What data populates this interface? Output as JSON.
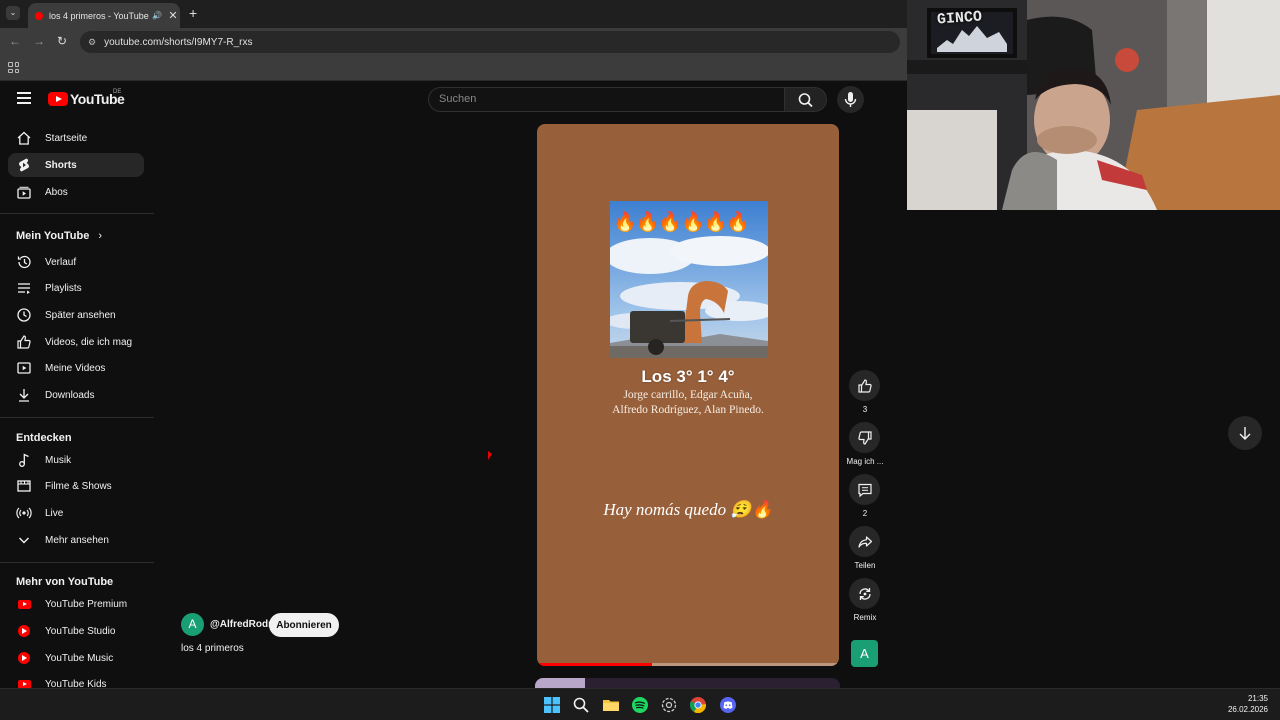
{
  "browser": {
    "tab_title": "los 4 primeros - YouTube",
    "tab_close": "✕",
    "new_tab": "+",
    "url": "youtube.com/shorts/I9MY7-R_rxs"
  },
  "header": {
    "logo_text": "YouTube",
    "country_code": "DE",
    "search_placeholder": "Suchen"
  },
  "sidebar": {
    "main_items": [
      {
        "label": "Startseite",
        "icon": "home-icon"
      },
      {
        "label": "Shorts",
        "icon": "shorts-icon",
        "active": true
      },
      {
        "label": "Abos",
        "icon": "subscriptions-icon"
      }
    ],
    "you_heading": "Mein YouTube",
    "you_items": [
      {
        "label": "Verlauf",
        "icon": "history-icon"
      },
      {
        "label": "Playlists",
        "icon": "playlists-icon"
      },
      {
        "label": "Später ansehen",
        "icon": "watch-later-icon"
      },
      {
        "label": "Videos, die ich mag",
        "icon": "liked-videos-icon"
      },
      {
        "label": "Meine Videos",
        "icon": "my-videos-icon"
      },
      {
        "label": "Downloads",
        "icon": "downloads-icon"
      }
    ],
    "explore_heading": "Entdecken",
    "explore_items": [
      {
        "label": "Musik",
        "icon": "music-icon"
      },
      {
        "label": "Filme & Shows",
        "icon": "movies-icon"
      },
      {
        "label": "Live",
        "icon": "live-icon"
      },
      {
        "label": "Mehr ansehen",
        "icon": "chevron-down-icon"
      }
    ],
    "more_heading": "Mehr von YouTube",
    "more_items": [
      {
        "label": "YouTube Premium",
        "icon": "youtube-premium-icon"
      },
      {
        "label": "YouTube Studio",
        "icon": "youtube-studio-icon"
      },
      {
        "label": "YouTube Music",
        "icon": "youtube-music-icon"
      },
      {
        "label": "YouTube Kids",
        "icon": "youtube-kids-icon"
      }
    ]
  },
  "short": {
    "fires": "🔥🔥🔥🔥🔥🔥",
    "heading": "Los 3° 1° 4°",
    "names": "Jorge carrillo, Edgar Acuña, Alfredo Rodríguez, Alan Pinedo.",
    "caption": "Hay nomás quedo 😮‍💨🔥",
    "progress": 0.38,
    "background_color": "#98603a",
    "channel_initial": "A",
    "channel_handle": "@AlfredRodr",
    "subscribe_label": "Abonnieren",
    "title": "los 4 primeros"
  },
  "actions": {
    "likes": "3",
    "dislike_label": "Mag ich ...",
    "comments": "2",
    "share_label": "Teilen",
    "remix_label": "Remix",
    "avatar_initial": "A"
  },
  "webcam": {
    "sign_text": "GINCO"
  },
  "taskbar": {
    "time": "21:35",
    "date": "26.02.2026"
  },
  "colors": {
    "accent": "#ff0000",
    "avatar": "#1a9e74",
    "background": "#0f0f0f"
  }
}
